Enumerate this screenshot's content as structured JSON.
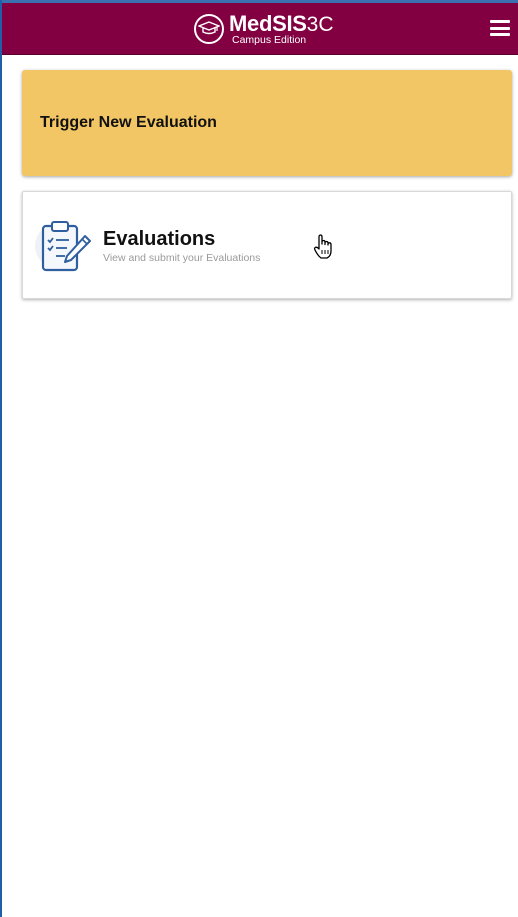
{
  "header": {
    "app_name": "MedSIS",
    "app_version": "3C",
    "edition": "Campus Edition",
    "brand_color": "#820041",
    "logo_icon": "graduation-cap-icon",
    "menu_icon": "hamburger-menu-icon"
  },
  "trigger_card": {
    "label": "Trigger New Evaluation",
    "background": "#f2c664"
  },
  "evaluations_card": {
    "title": "Evaluations",
    "subtitle": "View and submit your Evaluations",
    "icon": "clipboard-checklist-icon"
  },
  "cursor": {
    "icon": "hand-pointer-icon"
  }
}
